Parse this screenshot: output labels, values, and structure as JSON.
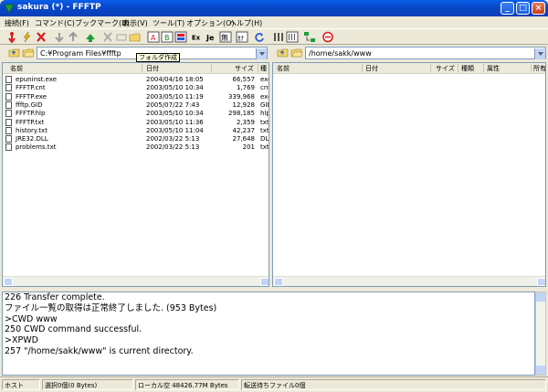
{
  "window": {
    "title": "sakura (*) - FFFTP"
  },
  "menu": [
    "接続(F)",
    "コマンド(C)",
    "ブックマーク(B)",
    "表示(V)",
    "ツール(T)",
    "オプション(O)",
    "ヘルプ(H)"
  ],
  "tooltip": "フォルダ作成",
  "toolbar_labels": {
    "ex": "Ex",
    "je": "Je",
    "mu": "無",
    "kana": "ｶﾅ"
  },
  "local": {
    "path": "C:¥Program Files¥ffftp",
    "columns": {
      "name": "名前",
      "date": "日付",
      "size": "サイズ",
      "type": "種"
    },
    "files": [
      {
        "name": "epuninst.exe",
        "date": "2004/04/16 18:05",
        "size": "66,557",
        "type": "exe"
      },
      {
        "name": "FFFTP.cnt",
        "date": "2003/05/10 10:34",
        "size": "1,769",
        "type": "cnt"
      },
      {
        "name": "FFFTP.exe",
        "date": "2003/05/10 11:19",
        "size": "339,968",
        "type": "exe"
      },
      {
        "name": "ffftp.GID",
        "date": "2005/07/22 7:43",
        "size": "12,928",
        "type": "GID"
      },
      {
        "name": "FFFTP.hlp",
        "date": "2003/05/10 10:34",
        "size": "298,185",
        "type": "hlp"
      },
      {
        "name": "FFFTP.txt",
        "date": "2003/05/10 11:36",
        "size": "2,359",
        "type": "txt"
      },
      {
        "name": "history.txt",
        "date": "2003/05/10 11:04",
        "size": "42,237",
        "type": "txt"
      },
      {
        "name": "JRE32.DLL",
        "date": "2002/03/22 5:13",
        "size": "27,648",
        "type": "DLL"
      },
      {
        "name": "problems.txt",
        "date": "2002/03/22 5:13",
        "size": "201",
        "type": "txt"
      }
    ]
  },
  "remote": {
    "path": "/home/sakk/www",
    "columns": {
      "name": "名前",
      "date": "日付",
      "size": "サイズ",
      "type": "種類",
      "attr": "属性",
      "owner": "所有"
    }
  },
  "log": [
    "226 Transfer complete.",
    "ファイル一覧の取得は正常終了しました. (953 Bytes)",
    ">CWD www",
    "250 CWD command successful.",
    ">XPWD",
    "257 \"/home/sakk/www\" is current directory."
  ],
  "status": {
    "host": "ホスト",
    "selected": "選択0個(0 Bytes)",
    "local_free": "ローカル空 48426.77M Bytes",
    "queue": "転送待ちファイル0個"
  },
  "colors": {
    "titlebar": "#0a5ee8",
    "window_bg": "#ece9d8",
    "tooltip_bg": "#ffffe1"
  }
}
